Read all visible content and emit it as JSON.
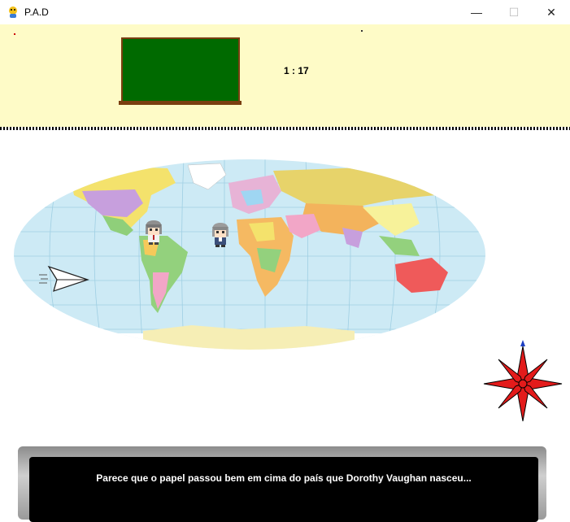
{
  "window": {
    "title": "P.A.D",
    "icons": {
      "app": "pygame-snake-icon",
      "minimize": "minimize-icon",
      "maximize": "maximize-icon",
      "close": "close-icon"
    },
    "minimize_glyph": "—",
    "maximize_glyph": "☐",
    "close_glyph": "✕"
  },
  "hud": {
    "timer": "1 : 17",
    "colors": {
      "panel": "#fefbc7",
      "blackboard": "#006a00",
      "board_frame": "#7a3e10"
    }
  },
  "scene": {
    "map": "world-political-map",
    "characters": [
      "student-character-1",
      "student-character-2"
    ],
    "paper_plane": "paper-plane-icon",
    "compass": "compass-rose-icon"
  },
  "dialog": {
    "text": "Parece que o papel passou bem em cima do país que Dorothy Vaughan nasceu..."
  }
}
